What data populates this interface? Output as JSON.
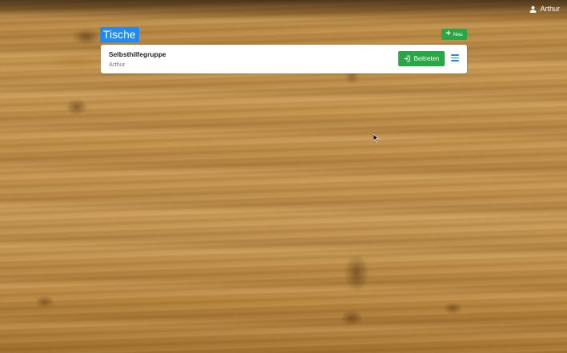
{
  "header": {
    "user_name": "Arthur",
    "user_icon": "user-icon"
  },
  "page": {
    "title": "Tische",
    "new_button_label": "Neu",
    "new_button_icon": "plus-icon"
  },
  "tables": [
    {
      "name": "Selbsthilfegruppe",
      "owner": "Arthur",
      "join_label": "Beitreten",
      "join_icon": "sign-in-icon",
      "menu_icon": "hamburger-menu-icon"
    }
  ],
  "colors": {
    "accent_blue": "#1f8bfa",
    "success_green": "#28a745",
    "card_bg": "#ffffff"
  }
}
